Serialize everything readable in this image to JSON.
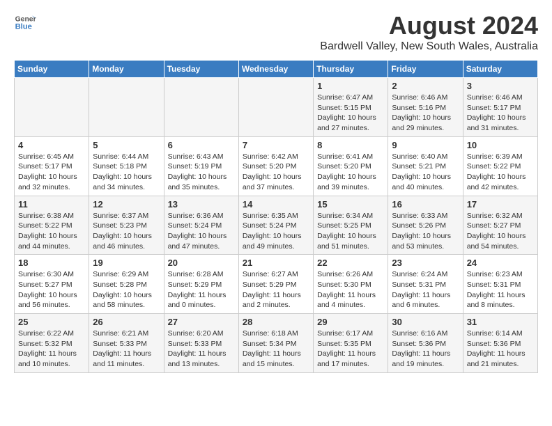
{
  "header": {
    "logo_line1": "General",
    "logo_line2": "Blue",
    "title": "August 2024",
    "subtitle": "Bardwell Valley, New South Wales, Australia"
  },
  "calendar": {
    "days_of_week": [
      "Sunday",
      "Monday",
      "Tuesday",
      "Wednesday",
      "Thursday",
      "Friday",
      "Saturday"
    ],
    "weeks": [
      [
        {
          "day": "",
          "info": ""
        },
        {
          "day": "",
          "info": ""
        },
        {
          "day": "",
          "info": ""
        },
        {
          "day": "",
          "info": ""
        },
        {
          "day": "1",
          "info": "Sunrise: 6:47 AM\nSunset: 5:15 PM\nDaylight: 10 hours\nand 27 minutes."
        },
        {
          "day": "2",
          "info": "Sunrise: 6:46 AM\nSunset: 5:16 PM\nDaylight: 10 hours\nand 29 minutes."
        },
        {
          "day": "3",
          "info": "Sunrise: 6:46 AM\nSunset: 5:17 PM\nDaylight: 10 hours\nand 31 minutes."
        }
      ],
      [
        {
          "day": "4",
          "info": "Sunrise: 6:45 AM\nSunset: 5:17 PM\nDaylight: 10 hours\nand 32 minutes."
        },
        {
          "day": "5",
          "info": "Sunrise: 6:44 AM\nSunset: 5:18 PM\nDaylight: 10 hours\nand 34 minutes."
        },
        {
          "day": "6",
          "info": "Sunrise: 6:43 AM\nSunset: 5:19 PM\nDaylight: 10 hours\nand 35 minutes."
        },
        {
          "day": "7",
          "info": "Sunrise: 6:42 AM\nSunset: 5:20 PM\nDaylight: 10 hours\nand 37 minutes."
        },
        {
          "day": "8",
          "info": "Sunrise: 6:41 AM\nSunset: 5:20 PM\nDaylight: 10 hours\nand 39 minutes."
        },
        {
          "day": "9",
          "info": "Sunrise: 6:40 AM\nSunset: 5:21 PM\nDaylight: 10 hours\nand 40 minutes."
        },
        {
          "day": "10",
          "info": "Sunrise: 6:39 AM\nSunset: 5:22 PM\nDaylight: 10 hours\nand 42 minutes."
        }
      ],
      [
        {
          "day": "11",
          "info": "Sunrise: 6:38 AM\nSunset: 5:22 PM\nDaylight: 10 hours\nand 44 minutes."
        },
        {
          "day": "12",
          "info": "Sunrise: 6:37 AM\nSunset: 5:23 PM\nDaylight: 10 hours\nand 46 minutes."
        },
        {
          "day": "13",
          "info": "Sunrise: 6:36 AM\nSunset: 5:24 PM\nDaylight: 10 hours\nand 47 minutes."
        },
        {
          "day": "14",
          "info": "Sunrise: 6:35 AM\nSunset: 5:24 PM\nDaylight: 10 hours\nand 49 minutes."
        },
        {
          "day": "15",
          "info": "Sunrise: 6:34 AM\nSunset: 5:25 PM\nDaylight: 10 hours\nand 51 minutes."
        },
        {
          "day": "16",
          "info": "Sunrise: 6:33 AM\nSunset: 5:26 PM\nDaylight: 10 hours\nand 53 minutes."
        },
        {
          "day": "17",
          "info": "Sunrise: 6:32 AM\nSunset: 5:27 PM\nDaylight: 10 hours\nand 54 minutes."
        }
      ],
      [
        {
          "day": "18",
          "info": "Sunrise: 6:30 AM\nSunset: 5:27 PM\nDaylight: 10 hours\nand 56 minutes."
        },
        {
          "day": "19",
          "info": "Sunrise: 6:29 AM\nSunset: 5:28 PM\nDaylight: 10 hours\nand 58 minutes."
        },
        {
          "day": "20",
          "info": "Sunrise: 6:28 AM\nSunset: 5:29 PM\nDaylight: 11 hours\nand 0 minutes."
        },
        {
          "day": "21",
          "info": "Sunrise: 6:27 AM\nSunset: 5:29 PM\nDaylight: 11 hours\nand 2 minutes."
        },
        {
          "day": "22",
          "info": "Sunrise: 6:26 AM\nSunset: 5:30 PM\nDaylight: 11 hours\nand 4 minutes."
        },
        {
          "day": "23",
          "info": "Sunrise: 6:24 AM\nSunset: 5:31 PM\nDaylight: 11 hours\nand 6 minutes."
        },
        {
          "day": "24",
          "info": "Sunrise: 6:23 AM\nSunset: 5:31 PM\nDaylight: 11 hours\nand 8 minutes."
        }
      ],
      [
        {
          "day": "25",
          "info": "Sunrise: 6:22 AM\nSunset: 5:32 PM\nDaylight: 11 hours\nand 10 minutes."
        },
        {
          "day": "26",
          "info": "Sunrise: 6:21 AM\nSunset: 5:33 PM\nDaylight: 11 hours\nand 11 minutes."
        },
        {
          "day": "27",
          "info": "Sunrise: 6:20 AM\nSunset: 5:33 PM\nDaylight: 11 hours\nand 13 minutes."
        },
        {
          "day": "28",
          "info": "Sunrise: 6:18 AM\nSunset: 5:34 PM\nDaylight: 11 hours\nand 15 minutes."
        },
        {
          "day": "29",
          "info": "Sunrise: 6:17 AM\nSunset: 5:35 PM\nDaylight: 11 hours\nand 17 minutes."
        },
        {
          "day": "30",
          "info": "Sunrise: 6:16 AM\nSunset: 5:36 PM\nDaylight: 11 hours\nand 19 minutes."
        },
        {
          "day": "31",
          "info": "Sunrise: 6:14 AM\nSunset: 5:36 PM\nDaylight: 11 hours\nand 21 minutes."
        }
      ]
    ]
  }
}
